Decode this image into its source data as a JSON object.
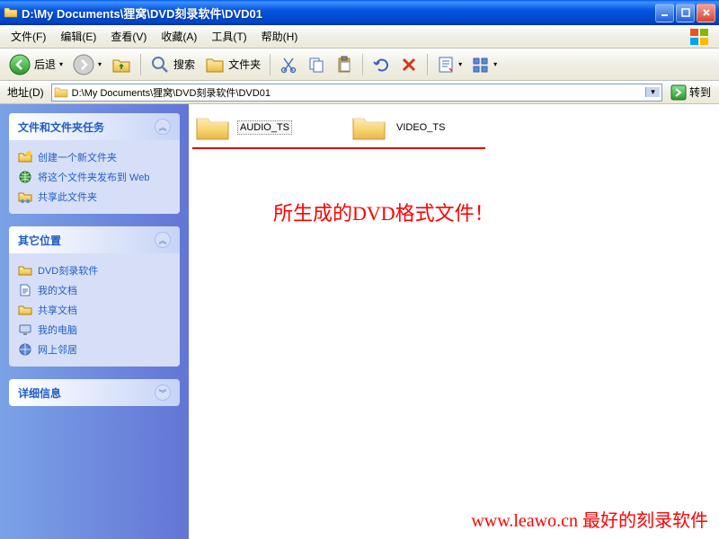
{
  "window": {
    "title": "D:\\My Documents\\狸窝\\DVD刻录软件\\DVD01",
    "min": "_",
    "max": "□",
    "close": "×"
  },
  "menu": {
    "file": "文件(F)",
    "edit": "编辑(E)",
    "view": "查看(V)",
    "favorites": "收藏(A)",
    "tools": "工具(T)",
    "help": "帮助(H)"
  },
  "toolbar": {
    "back": "后退",
    "search": "搜索",
    "folders": "文件夹"
  },
  "address": {
    "label": "地址(D)",
    "path": "D:\\My Documents\\狸窝\\DVD刻录软件\\DVD01",
    "go": "转到"
  },
  "sidebar": {
    "tasks": {
      "title": "文件和文件夹任务",
      "items": [
        {
          "label": "创建一个新文件夹"
        },
        {
          "label": "将这个文件夹发布到 Web"
        },
        {
          "label": "共享此文件夹"
        }
      ]
    },
    "other": {
      "title": "其它位置",
      "items": [
        {
          "label": "DVD刻录软件"
        },
        {
          "label": "我的文档"
        },
        {
          "label": "共享文档"
        },
        {
          "label": "我的电脑"
        },
        {
          "label": "网上邻居"
        }
      ]
    },
    "details": {
      "title": "详细信息"
    }
  },
  "folders": [
    {
      "name": "AUDIO_TS"
    },
    {
      "name": "VIDEO_TS"
    }
  ],
  "annotation": "所生成的DVD格式文件！",
  "watermark": "www.leawo.cn 最好的刻录软件"
}
